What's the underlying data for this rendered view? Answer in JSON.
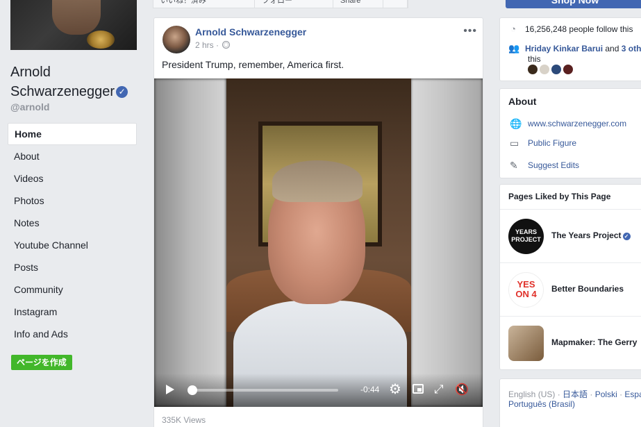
{
  "left": {
    "page_name_line1": "Arnold",
    "page_name_line2": "Schwarzenegger",
    "verified_glyph": "✓",
    "handle": "@arnold",
    "nav": [
      "Home",
      "About",
      "Videos",
      "Photos",
      "Notes",
      "Youtube Channel",
      "Posts",
      "Community",
      "Instagram",
      "Info and Ads"
    ],
    "create_page": "ページを作成"
  },
  "header": {
    "shop_now": "Shop Now",
    "action_buttons": [
      "いいね！済み",
      "フォロー",
      "Share"
    ]
  },
  "post": {
    "author": "Arnold Schwarzenegger",
    "time": "2 hrs",
    "meta_sep": " · ",
    "more": "•••",
    "text": "President Trump, remember, America first.",
    "video": {
      "time_remaining": "-0:44",
      "progress": 0
    },
    "views": "335K Views"
  },
  "right": {
    "followers": "16,256,248 people follow this",
    "friends_name": "Hriday Kinkar Barui",
    "friends_and": " and ",
    "friends_more": "3 oth",
    "friends_tail": "this",
    "about_title": "About",
    "website": "www.schwarzenegger.com",
    "category": "Public Figure",
    "suggest": "Suggest Edits",
    "liked_title": "Pages Liked by This Page",
    "liked": [
      {
        "name": "The Years Project",
        "verified": true
      },
      {
        "name": "Better Boundaries",
        "verified": false
      },
      {
        "name": "Mapmaker: The Gerry",
        "verified": false
      }
    ],
    "thumb_years_text": "YEARS PROJECT",
    "thumb_yes_text": "YES ON 4",
    "languages_line1": [
      "English (US)",
      "日本語",
      "Polski",
      "Españ"
    ],
    "languages_line2": [
      "Português (Brasil)"
    ],
    "lang_sep": " · "
  },
  "colors": {
    "brand_blue": "#4267b2",
    "link_blue": "#365899",
    "create_green": "#42b72a",
    "page_bg": "#e9ebee"
  }
}
